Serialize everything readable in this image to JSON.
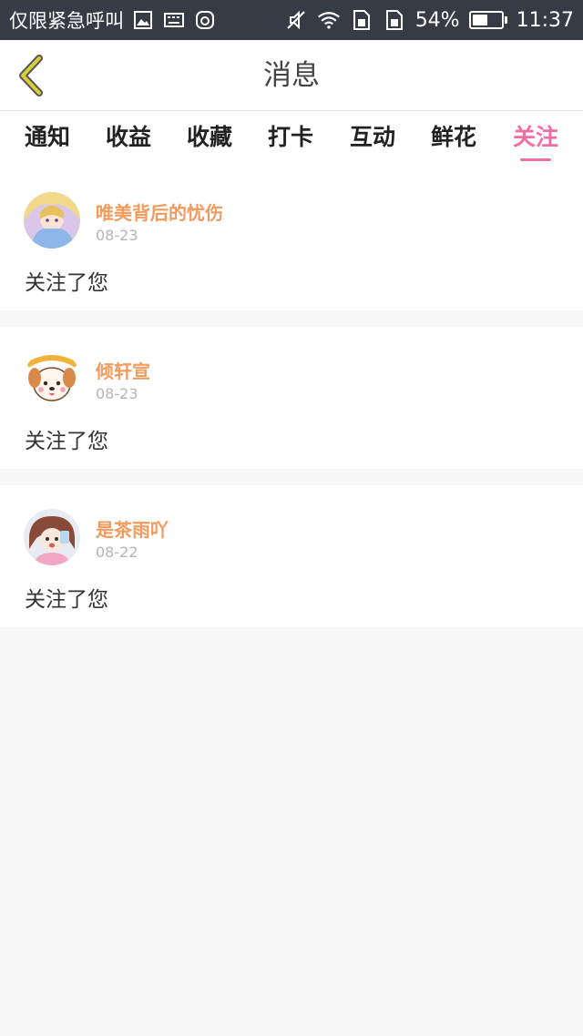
{
  "status_bar": {
    "carrier": "仅限紧急呼叫",
    "battery": "54%",
    "battery_level": 0.54,
    "time": "11:37"
  },
  "header": {
    "title": "消息",
    "back_icon": "chevron-left-icon"
  },
  "tabs": [
    {
      "label": "通知",
      "active": false
    },
    {
      "label": "收益",
      "active": false
    },
    {
      "label": "收藏",
      "active": false
    },
    {
      "label": "打卡",
      "active": false
    },
    {
      "label": "互动",
      "active": false
    },
    {
      "label": "鲜花",
      "active": false
    },
    {
      "label": "关注",
      "active": true
    }
  ],
  "messages": [
    {
      "user": "唯美背后的忧伤",
      "date": "08-23",
      "text": "关注了您"
    },
    {
      "user": "倾轩宣",
      "date": "08-23",
      "text": "关注了您"
    },
    {
      "user": "是茶雨吖",
      "date": "08-22",
      "text": "关注了您"
    }
  ],
  "colors": {
    "status_bar_bg": "#373b45",
    "accent_pink": "#ef6fa0",
    "username_orange": "#f39a5d",
    "back_arrow": "#d8cd3a",
    "page_bg": "#f7f7f7"
  }
}
